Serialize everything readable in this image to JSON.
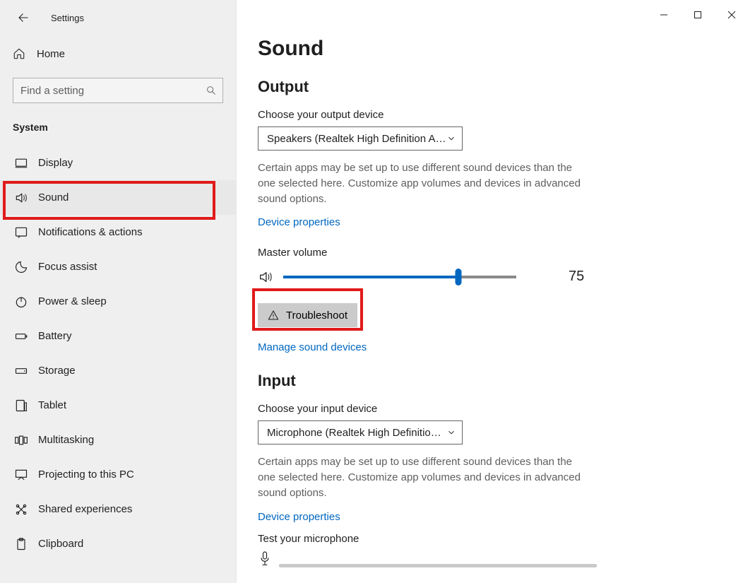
{
  "window": {
    "title": "Settings"
  },
  "sidebar": {
    "home": "Home",
    "search_placeholder": "Find a setting",
    "category": "System",
    "items": [
      {
        "label": "Display"
      },
      {
        "label": "Sound"
      },
      {
        "label": "Notifications & actions"
      },
      {
        "label": "Focus assist"
      },
      {
        "label": "Power & sleep"
      },
      {
        "label": "Battery"
      },
      {
        "label": "Storage"
      },
      {
        "label": "Tablet"
      },
      {
        "label": "Multitasking"
      },
      {
        "label": "Projecting to this PC"
      },
      {
        "label": "Shared experiences"
      },
      {
        "label": "Clipboard"
      }
    ]
  },
  "page": {
    "title": "Sound",
    "output": {
      "heading": "Output",
      "choose_label": "Choose your output device",
      "device": "Speakers (Realtek High Definition A…",
      "desc": "Certain apps may be set up to use different sound devices than the one selected here. Customize app volumes and devices in advanced sound options.",
      "props_link": "Device properties",
      "vol_label": "Master volume",
      "vol_value": "75",
      "troubleshoot": "Troubleshoot",
      "manage_link": "Manage sound devices"
    },
    "input": {
      "heading": "Input",
      "choose_label": "Choose your input device",
      "device": "Microphone (Realtek High Definitio…",
      "desc": "Certain apps may be set up to use different sound devices than the one selected here. Customize app volumes and devices in advanced sound options.",
      "props_link": "Device properties",
      "test_label": "Test your microphone"
    }
  }
}
